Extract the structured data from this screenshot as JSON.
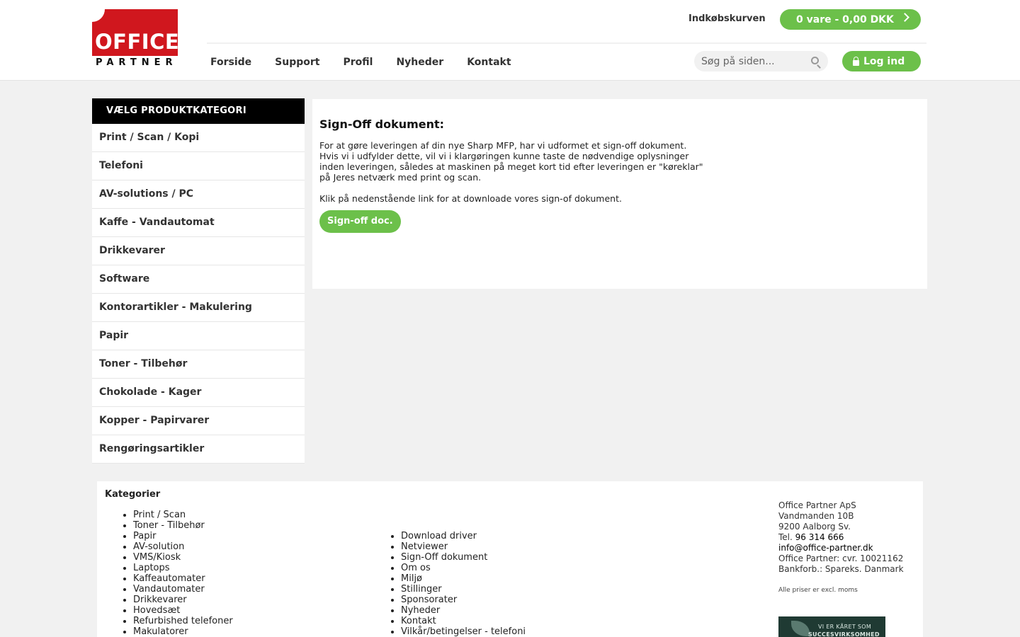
{
  "header": {
    "logo_word": "OFFICE",
    "logo_sub": "PARTNER",
    "cart_link": "Indkøbskurven",
    "cart_button": "0 vare - 0,00 DKK",
    "nav": [
      "Forside",
      "Support",
      "Profil",
      "Nyheder",
      "Kontakt"
    ],
    "search_placeholder": "Søg på siden...",
    "login": "Log ind"
  },
  "sidebar": {
    "title": "VÆLG PRODUKTKATEGORI",
    "items": [
      "Print / Scan / Kopi",
      "Telefoni",
      "AV-solutions / PC",
      "Kaffe - Vandautomat",
      "Drikkevarer",
      "Software",
      "Kontorartikler - Makulering",
      "Papir",
      "Toner - Tilbehør",
      "Chokolade - Kager",
      "Kopper - Papirvarer",
      "Rengøringsartikler"
    ]
  },
  "main": {
    "title": "Sign-Off dokument:",
    "para_lines": [
      "For at gøre leveringen af din nye Sharp MFP, har vi udformet et sign-off dokument.",
      "Hvis vi i udfylder dette, vil vi i klargøringen kunne taste de nødvendige oplysninger",
      "inden leveringen, således at maskinen på meget kort tid efter leveringen er \"køreklar\"",
      "på Jeres netværk med print og scan."
    ],
    "link_text": "Klik på nedenstående link for at downloade vores sign-of dokument.",
    "button": "Sign-off doc."
  },
  "footer": {
    "heading": "Kategorier",
    "col1": [
      "Print / Scan",
      "Toner - Tilbehør",
      "Papir",
      "AV-solution",
      "VMS/Kiosk",
      "Laptops",
      "Kaffeautomater",
      "Vandautomater",
      "Drikkevarer",
      "Hovedsæt",
      "Refurbished telefoner",
      "Makulatorer"
    ],
    "col2": [
      "Download driver",
      "Netviewer",
      "Sign-Off dokument",
      "Om os",
      "Miljø",
      "Stillinger",
      "Sponsorater",
      "Nyheder",
      "Kontakt",
      "Vilkår/betingelser - telefoni"
    ],
    "address": {
      "company": "Office Partner ApS",
      "street": "Vandmanden 10B",
      "city": "9200 Aalborg Sv.",
      "tel_label": "Tel.",
      "tel": "96 314 666",
      "email": "info@office-partner.dk",
      "cvr": "Office Partner: cvr. 10021162",
      "bank": "Bankforb.: Spareks. Danmark"
    },
    "note": "Alle priser er excl. moms",
    "badge_line1": "VI ER KÅRET SOM",
    "badge_line2": "SUCCESVIRKSOMHED"
  },
  "colors": {
    "accent_green": "#6cc04a",
    "logo_red": "#d0171e",
    "sidebar_head": "#000000"
  }
}
